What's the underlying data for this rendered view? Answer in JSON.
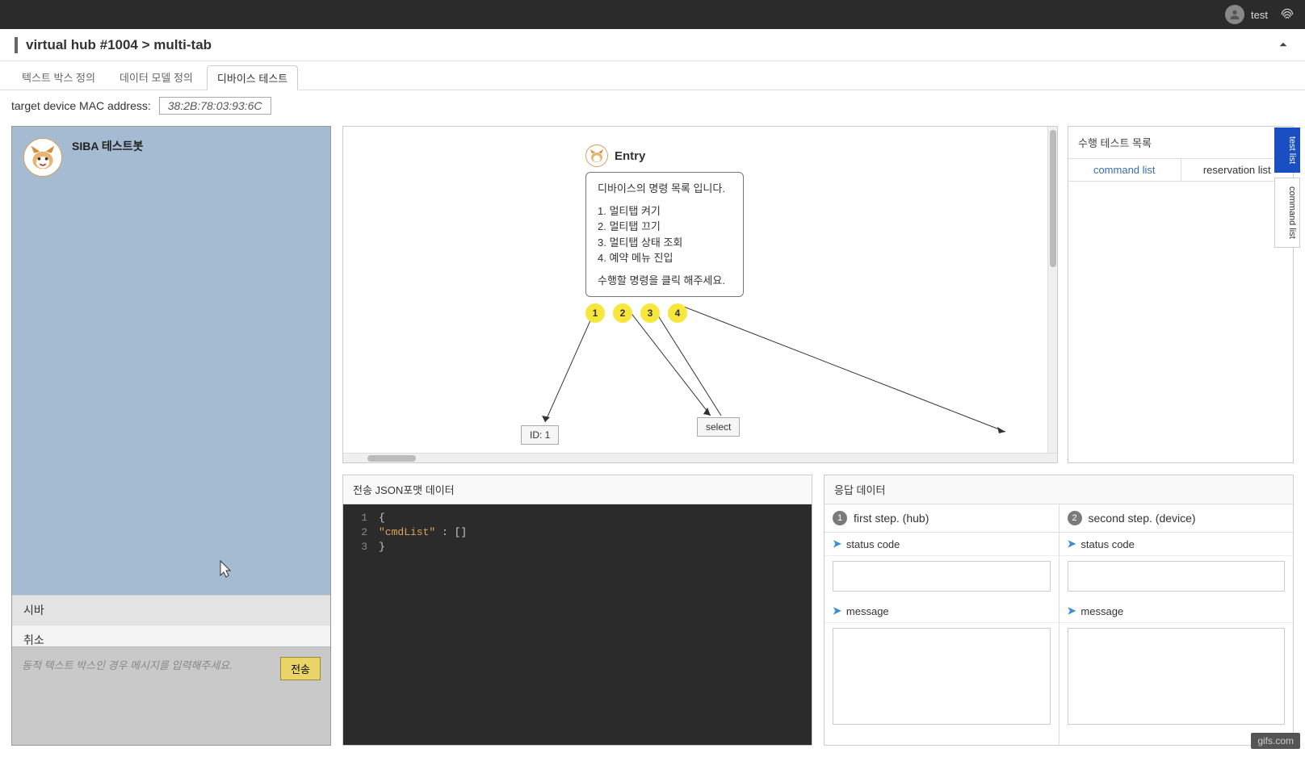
{
  "topbar": {
    "username": "test"
  },
  "breadcrumb": {
    "text": "virtual hub #1004 > multi-tab"
  },
  "tabs": [
    {
      "label": "텍스트 박스 정의",
      "active": false
    },
    {
      "label": "데이터 모델 정의",
      "active": false
    },
    {
      "label": "디바이스 테스트",
      "active": true
    }
  ],
  "target": {
    "label": "target device MAC address:",
    "mac": "38:2B:78:03:93:6C"
  },
  "chat": {
    "bot_name": "SIBA 테스트봇",
    "menu": [
      {
        "label": "시바"
      },
      {
        "label": "취소"
      }
    ],
    "input_placeholder": "동적 텍스트 박스인 경우 메시지를 입력해주세요.",
    "send_label": "전송"
  },
  "entry": {
    "title": "Entry",
    "header_text": "디바이스의 명령 목록 입니다.",
    "items": [
      "1. 멀티탭 켜기",
      "2. 멀티탭 끄기",
      "3. 멀티탭 상태 조회",
      "4. 예약 메뉴 진입"
    ],
    "footer_text": "수행할 명령을 클릭 해주세요.",
    "options": [
      "1",
      "2",
      "3",
      "4"
    ],
    "child1": "ID: 1",
    "child2": "select"
  },
  "test_list": {
    "title": "수행 테스트 목록",
    "tab1": "command list",
    "tab2": "reservation list"
  },
  "side_tabs": {
    "tab1": "test list",
    "tab2": "command list"
  },
  "json_panel": {
    "title": "전송 JSON포맷 데이터",
    "lines": [
      {
        "num": "1",
        "tokens": [
          {
            "t": "{",
            "cls": "code-punct"
          }
        ]
      },
      {
        "num": "2",
        "tokens": [
          {
            "t": "    ",
            "cls": ""
          },
          {
            "t": "\"cmdList\"",
            "cls": "code-key"
          },
          {
            "t": " : []",
            "cls": "code-punct"
          }
        ]
      },
      {
        "num": "3",
        "tokens": [
          {
            "t": "}",
            "cls": "code-punct"
          }
        ]
      }
    ]
  },
  "response": {
    "title": "응답 데이터",
    "steps": [
      {
        "num": "1",
        "label": "first step. (hub)"
      },
      {
        "num": "2",
        "label": "second step. (device)"
      }
    ],
    "field_status": "status code",
    "field_message": "message"
  },
  "watermark": "gifs.com"
}
